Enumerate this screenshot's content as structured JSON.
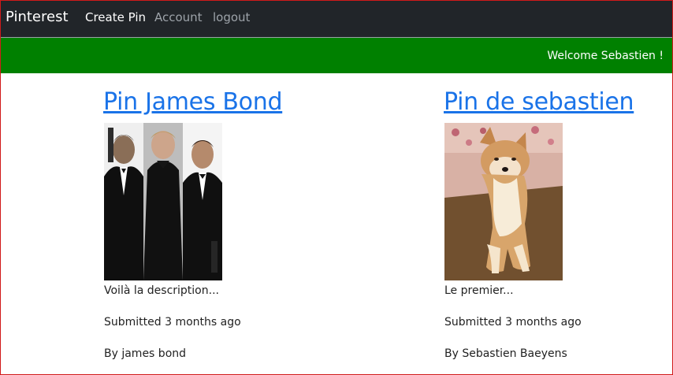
{
  "navbar": {
    "brand": "Pinterest",
    "links": [
      "Create Pin",
      "Account",
      "logout"
    ]
  },
  "welcome_bar": {
    "text": "Welcome Sebastien !"
  },
  "pins": [
    {
      "title": "Pin James Bond",
      "description": "Voilà la description...",
      "submitted": "Submitted 3 months ago",
      "author": "By james bond"
    },
    {
      "title": "Pin de sebastien",
      "description": "Le premier...",
      "submitted": "Submitted 3 months ago",
      "author": "By Sebastien Baeyens"
    }
  ],
  "colors": {
    "navbar_bg": "#212529",
    "welcome_bg": "#008000",
    "link_blue": "#1a73e8",
    "border_red": "#d11a1a"
  }
}
